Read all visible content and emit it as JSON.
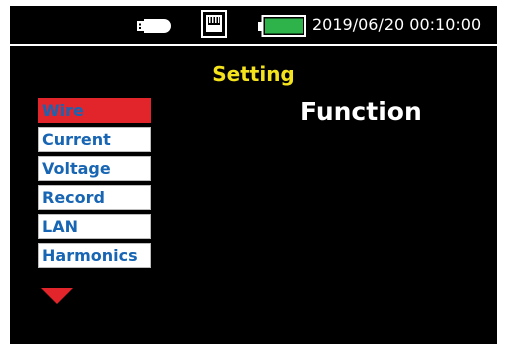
{
  "status_bar": {
    "icons": [
      "usb-drive-icon",
      "lan-port-icon",
      "battery-full-icon"
    ],
    "datetime": "2019/06/20 00:10:00"
  },
  "page": {
    "title": "Setting",
    "panel_title": "Function"
  },
  "menu": {
    "items": [
      {
        "label": "Wire",
        "selected": true
      },
      {
        "label": "Current",
        "selected": false
      },
      {
        "label": "Voltage",
        "selected": false
      },
      {
        "label": "Record",
        "selected": false
      },
      {
        "label": "LAN",
        "selected": false
      },
      {
        "label": "Harmonics",
        "selected": false
      }
    ],
    "more_indicator": "triangle-down-icon"
  },
  "colors": {
    "background": "#000000",
    "title": "#f3e21c",
    "menu_text": "#1765b3",
    "menu_selected": "#e2242b",
    "battery": "#2db34a",
    "arrow": "#e2242b"
  }
}
